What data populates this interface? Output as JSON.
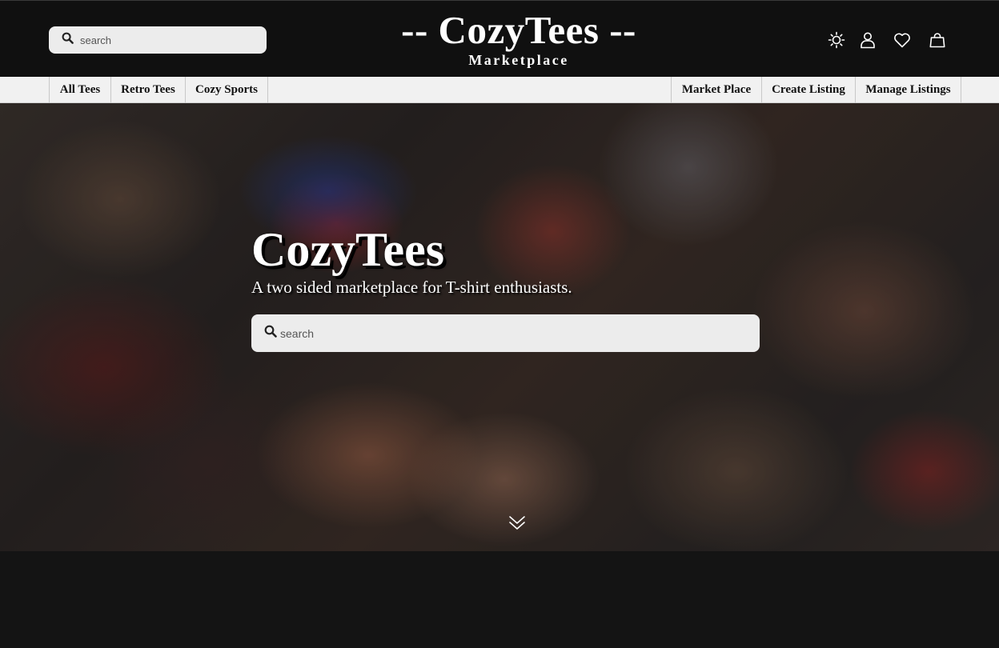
{
  "header": {
    "search": {
      "placeholder": "search"
    },
    "brand": {
      "title": "-- CozyTees --",
      "subtitle": "Marketplace"
    },
    "icons": [
      "theme-toggle-icon",
      "user-icon",
      "heart-icon",
      "cart-icon"
    ]
  },
  "nav": {
    "left_items": [
      {
        "label": "All Tees"
      },
      {
        "label": "Retro Tees"
      },
      {
        "label": "Cozy Sports"
      }
    ],
    "right_items": [
      {
        "label": "Market Place"
      },
      {
        "label": "Create Listing"
      },
      {
        "label": "Manage Listings"
      }
    ]
  },
  "hero": {
    "title": "CozyTees",
    "tagline": "A two sided marketplace for T-shirt enthusiasts.",
    "search": {
      "placeholder": "search"
    }
  },
  "colors": {
    "header_bg": "#101010",
    "nav_bg": "#f1f1f1",
    "search_bg": "#ececec",
    "page_bg": "#141414"
  }
}
